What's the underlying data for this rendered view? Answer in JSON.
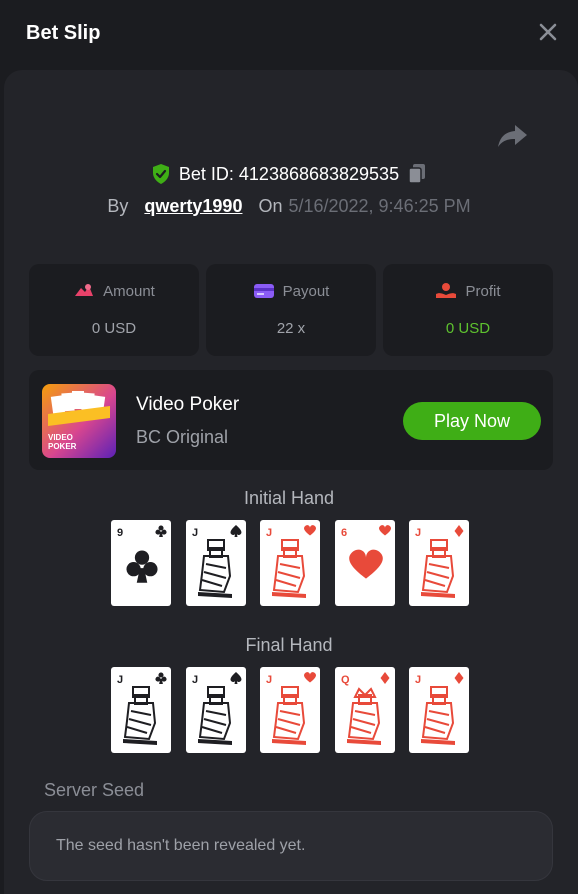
{
  "header": {
    "title": "Bet Slip"
  },
  "bet": {
    "id_label": "Bet ID: 4123868683829535",
    "by_label": "By",
    "user": "qwerty1990",
    "on_label": "On",
    "date": "5/16/2022, 9:46:25 PM"
  },
  "stats": {
    "amount_label": "Amount",
    "amount_value": "0 USD",
    "payout_label": "Payout",
    "payout_value": "22 x",
    "profit_label": "Profit",
    "profit_value": "0 USD"
  },
  "game": {
    "name": "Video Poker",
    "subtitle": "BC Original",
    "thumb_text_line1": "VIDEO",
    "thumb_text_line2": "POKER",
    "play_label": "Play Now"
  },
  "hands": {
    "initial_label": "Initial Hand",
    "final_label": "Final Hand",
    "initial": [
      {
        "rank": "9",
        "suit": "clubs"
      },
      {
        "rank": "J",
        "suit": "spades"
      },
      {
        "rank": "J",
        "suit": "hearts"
      },
      {
        "rank": "6",
        "suit": "hearts"
      },
      {
        "rank": "J",
        "suit": "diamonds"
      }
    ],
    "final": [
      {
        "rank": "J",
        "suit": "clubs"
      },
      {
        "rank": "J",
        "suit": "spades"
      },
      {
        "rank": "J",
        "suit": "hearts"
      },
      {
        "rank": "Q",
        "suit": "diamonds"
      },
      {
        "rank": "J",
        "suit": "diamonds"
      }
    ]
  },
  "seed": {
    "label": "Server Seed",
    "value": "The seed hasn't been revealed yet."
  },
  "colors": {
    "accent_green": "#3fae16",
    "profit_green": "#5ec22f",
    "red_suit": "#e84a3a",
    "black_suit": "#1e1e22"
  }
}
